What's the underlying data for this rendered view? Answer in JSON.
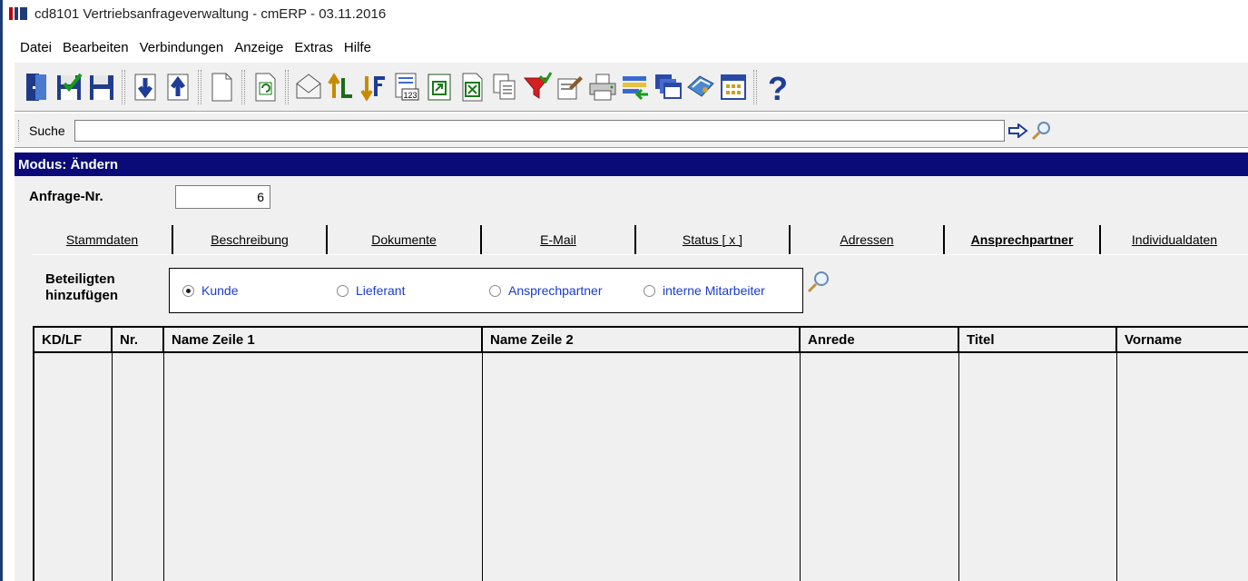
{
  "window": {
    "title": "cd8101 Vertriebsanfrageverwaltung - cmERP - 03.11.2016"
  },
  "menu": [
    "Datei",
    "Bearbeiten",
    "Verbindungen",
    "Anzeige",
    "Extras",
    "Hilfe"
  ],
  "search": {
    "label": "Suche",
    "value": ""
  },
  "mode": {
    "text": "Modus: Ändern"
  },
  "form": {
    "anfrage_label": "Anfrage-Nr.",
    "anfrage_value": "6"
  },
  "tabs": [
    {
      "label": "Stammdaten",
      "active": false
    },
    {
      "label": "Beschreibung",
      "active": false
    },
    {
      "label": "Dokumente",
      "active": false
    },
    {
      "label": "E-Mail",
      "active": false
    },
    {
      "label": "Status [ x ]",
      "active": false
    },
    {
      "label": "Adressen",
      "active": false
    },
    {
      "label": "Ansprechpartner",
      "active": true
    },
    {
      "label": "Individualdaten",
      "active": false
    }
  ],
  "beteiligte": {
    "label_line1": "Beteiligten",
    "label_line2": "hinzufügen",
    "options": [
      {
        "label": "Kunde",
        "checked": true
      },
      {
        "label": "Lieferant",
        "checked": false
      },
      {
        "label": "Ansprechpartner",
        "checked": false
      },
      {
        "label": "interne Mitarbeiter",
        "checked": false
      }
    ]
  },
  "table": {
    "columns": [
      "KD/LF",
      "Nr.",
      "Name Zeile 1",
      "Name Zeile 2",
      "Anrede",
      "Titel",
      "Vorname"
    ],
    "rows": []
  },
  "colors": {
    "mode_bar": "#0a0a78",
    "panel_bg": "#f0f0f0",
    "radio_text": "#1a3ccc"
  }
}
